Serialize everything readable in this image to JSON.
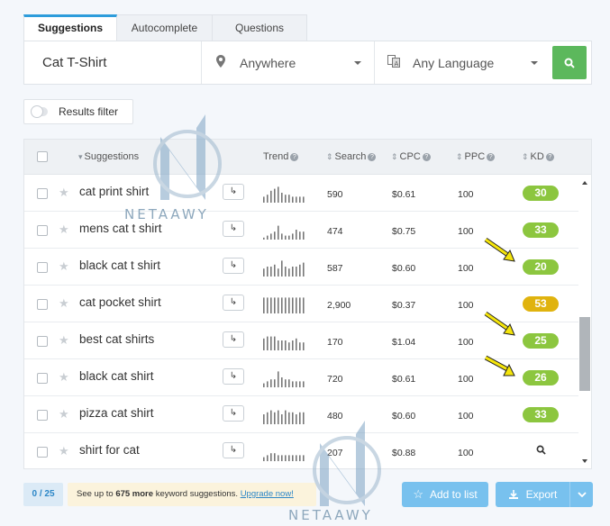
{
  "tabs": [
    {
      "label": "Suggestions",
      "active": true
    },
    {
      "label": "Autocomplete",
      "active": false
    },
    {
      "label": "Questions",
      "active": false
    }
  ],
  "search": {
    "keyword": "Cat T-Shirt",
    "location": "Anywhere",
    "language": "Any Language",
    "location_icon": "map-pin-icon",
    "language_icon": "translate-icon",
    "submit_icon": "search-icon",
    "submit_color": "#5cb85c"
  },
  "filter": {
    "label": "Results filter",
    "enabled": false
  },
  "table": {
    "columns": {
      "suggestions": "Suggestions",
      "trend": "Trend",
      "search": "Search",
      "cpc": "CPC",
      "ppc": "PPC",
      "kd": "KD"
    },
    "rows": [
      {
        "keyword": "cat print shirt",
        "search": "590",
        "cpc": "$0.61",
        "ppc": "100",
        "kd": "30",
        "kd_color": "#8cc63f",
        "trend": [
          3,
          4,
          6,
          7,
          8,
          5,
          4,
          4,
          3,
          3,
          3,
          3
        ]
      },
      {
        "keyword": "mens cat t shirt",
        "search": "474",
        "cpc": "$0.75",
        "ppc": "100",
        "kd": "33",
        "kd_color": "#8cc63f",
        "trend": [
          1,
          2,
          3,
          4,
          7,
          3,
          2,
          2,
          3,
          5,
          4,
          4
        ]
      },
      {
        "keyword": "black cat t shirt",
        "search": "587",
        "cpc": "$0.60",
        "ppc": "100",
        "kd": "20",
        "kd_color": "#8cc63f",
        "trend": [
          4,
          5,
          5,
          6,
          4,
          8,
          5,
          4,
          5,
          5,
          6,
          7
        ]
      },
      {
        "keyword": "cat pocket shirt",
        "search": "2,900",
        "cpc": "$0.37",
        "ppc": "100",
        "kd": "53",
        "kd_color": "#e0b30e",
        "trend": [
          8,
          8,
          8,
          8,
          8,
          8,
          8,
          8,
          8,
          8,
          8,
          8
        ]
      },
      {
        "keyword": "best cat shirts",
        "search": "170",
        "cpc": "$1.04",
        "ppc": "100",
        "kd": "25",
        "kd_color": "#8cc63f",
        "trend": [
          6,
          7,
          7,
          7,
          5,
          5,
          5,
          4,
          5,
          6,
          4,
          4
        ]
      },
      {
        "keyword": "black cat shirt",
        "search": "720",
        "cpc": "$0.61",
        "ppc": "100",
        "kd": "26",
        "kd_color": "#8cc63f",
        "trend": [
          2,
          3,
          4,
          4,
          8,
          5,
          4,
          4,
          3,
          3,
          3,
          3
        ]
      },
      {
        "keyword": "pizza cat shirt",
        "search": "480",
        "cpc": "$0.60",
        "ppc": "100",
        "kd": "33",
        "kd_color": "#8cc63f",
        "trend": [
          5,
          6,
          7,
          6,
          7,
          5,
          7,
          6,
          6,
          5,
          6,
          6
        ]
      },
      {
        "keyword": "shirt for cat",
        "search": "207",
        "cpc": "$0.88",
        "ppc": "100",
        "kd": "",
        "kd_color": "",
        "trend": [
          2,
          3,
          4,
          4,
          3,
          3,
          3,
          3,
          3,
          3,
          3,
          3
        ]
      }
    ]
  },
  "footer": {
    "counter": "0 / 25",
    "upgrade_text": "See up to",
    "upgrade_count": "675 more",
    "upgrade_tail": "keyword suggestions.",
    "upgrade_link": "Upgrade now!",
    "add_to_list": "Add to list",
    "export": "Export",
    "button_color": "#78c1ee"
  },
  "watermark": {
    "text": "NETAAWY"
  }
}
